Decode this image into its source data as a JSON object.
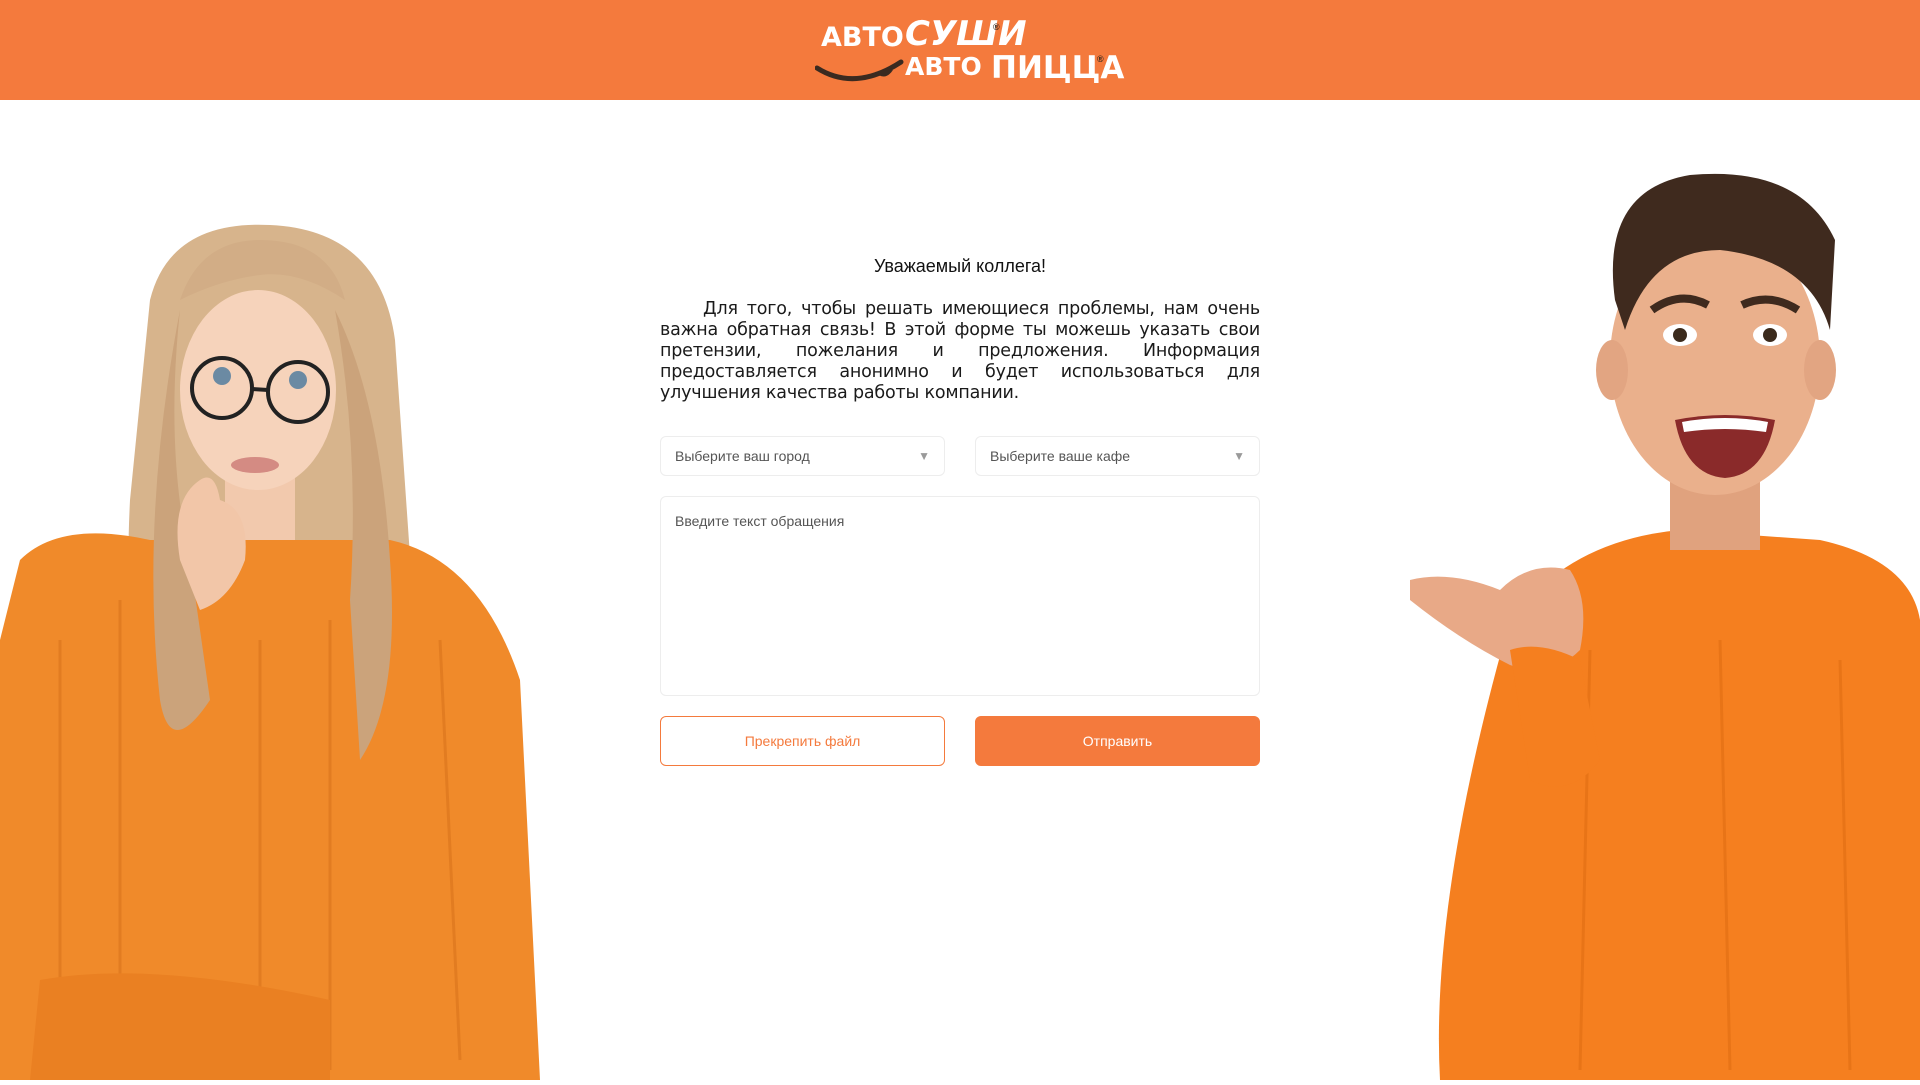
{
  "brand": {
    "line1_a": "АВТО",
    "line1_b": "СУШИ",
    "line2_a": "АВТО",
    "line2_b": "ПИЦЦА",
    "registered_mark": "®",
    "colors": {
      "accent": "#f47a3d",
      "smile": "#3a2a20"
    }
  },
  "form": {
    "title": "Уважаемый коллега!",
    "intro": "Для того, чтобы решать имеющиеся проблемы, нам очень важна обратная связь! В этой форме ты можешь указать свои претензии, пожелания и предложения. Информация предоставляется анонимно и будет использоваться для улучшения качества работы компании.",
    "city_select": {
      "value": "Выберите ваш город"
    },
    "cafe_select": {
      "value": "Выберите ваше кафе"
    },
    "message": {
      "placeholder": "Введите текст обращения"
    },
    "attach_label": "Прекрепить файл",
    "submit_label": "Отправить"
  },
  "images": {
    "left": "woman-in-orange-sweater-thinking",
    "right": "man-in-orange-sweater-pointing"
  },
  "icons": {
    "dropdown": "chevron-down-icon"
  }
}
